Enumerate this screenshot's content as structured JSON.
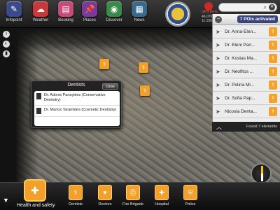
{
  "toolbar": {
    "items": [
      {
        "label": "Infopoint",
        "icon": "pencil-icon",
        "color": "#3a4a8a"
      },
      {
        "label": "Weather",
        "icon": "cloud-icon",
        "color": "#c83a3a"
      },
      {
        "label": "Booking",
        "icon": "book-icon",
        "color": "#c84a7a"
      },
      {
        "label": "Places",
        "icon": "pin-icon",
        "color": "#7a3a9a"
      },
      {
        "label": "Discover",
        "icon": "globe-icon",
        "color": "#3a8a4a"
      },
      {
        "label": "News",
        "icon": "newspaper-icon",
        "color": "#3a6a8a"
      }
    ]
  },
  "gps": {
    "label": "GPS Error",
    "lat": "46.0706",
    "lon": "11.1509"
  },
  "search": {
    "placeholder": "",
    "value": ""
  },
  "poi_panel": {
    "title": "7 POIs activated",
    "items": [
      "Dr. Anna-Elen...",
      "Dr. Eleni Pan...",
      "Dr. Kostas Ma...",
      "Dr. Neofitos ...",
      "Dr. Polina Mi...",
      "Dr. Sofia Pap...",
      "Nicosia Denta..."
    ],
    "footer": "Found 7 elements"
  },
  "popup": {
    "title": "Dentists",
    "close_label": "Close",
    "items": [
      "Dr. Adonis Panayides (Conservative Dentistry)",
      "Dr. Marios Taramides (Cosmetic Dentistry)"
    ]
  },
  "category": {
    "label": "Health and safety",
    "subcategories": [
      "Dentists",
      "Doctors",
      "Fire Brigade",
      "Hospital",
      "Police"
    ]
  },
  "colors": {
    "accent": "#f0a02b",
    "badge": "#39447a"
  }
}
